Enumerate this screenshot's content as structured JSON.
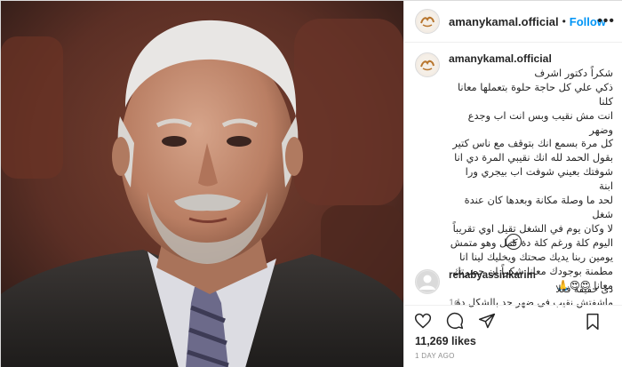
{
  "post": {
    "username": "amanykamal.official",
    "follow_label": "Follow",
    "separator": "•",
    "more_label": "•••",
    "caption": "شكراً دكتور اشرف\nذكي علي كل حاجة حلوة بتعملها معانا كلنا\nانت مش نقيب وبس انت اب وجدع وضهر\nكل مرة بسمع انك بتوقف مع ناس كتير\nبقول الحمد لله انك نقيبي المرة دي انا\nشوفتك بعيني شوفت اب بيجري ورا ابنة\nلحد ما وصلة مكانة وبعدها كان عندة شغل\nلا وكان يوم في الشغل تقيل اوي تقريباً\nاليوم كلة ورغم كلة دة كمل وهو متمش\nيومين ربنا يديك صحتك ويخليك لينا انا\nمطمنة بوجودك معانا شكراً ان حضرتك\nمعانا 😍😍🙏",
    "time_ago": "1d",
    "add_comment_icon": "plus-circle-icon"
  },
  "comment": {
    "username": "rehabyassinkarim",
    "text": "دى حقيقة فعلا\nماشفتش نقيب فى ضهر حد بالشكل ده"
  },
  "actions": {
    "icons": [
      "heart-icon",
      "comment-icon",
      "share-icon",
      "bookmark-icon"
    ]
  },
  "likes": "11,269 likes",
  "date": "1 DAY AGO"
}
